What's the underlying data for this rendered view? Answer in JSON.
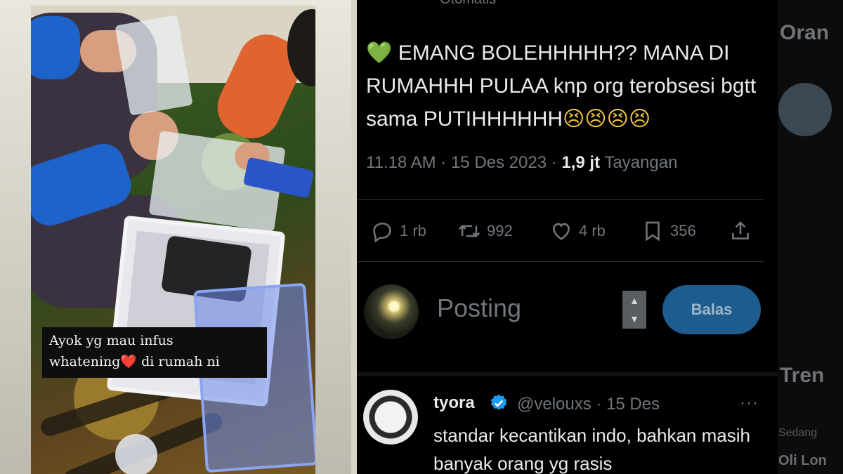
{
  "story": {
    "caption_line1": "Ayok yg mau infus",
    "caption_line2_prefix": "whatening",
    "caption_heart": "❤️",
    "caption_line2_suffix": " di rumah ni"
  },
  "tweet": {
    "top_label": "Otomatis",
    "heart_emoji": "💚",
    "text": "EMANG BOLEHHHHH??  MANA DI RUMAHHH PULAA knp org terobsesi bgtt sama PUTIHHHHHH",
    "emojis": "😣😣😣😣",
    "time": "11.18 AM · 15 Des 2023 · ",
    "views_count": "1,9 jt",
    "views_label": " Tayangan",
    "actions": {
      "replies": "1 rb",
      "retweets": "992",
      "likes": "4 rb",
      "bookmarks": "356"
    }
  },
  "composer": {
    "placeholder": "Posting",
    "reply_button": "Balas"
  },
  "reply": {
    "name": "tyora",
    "handle_date": "@velouxs · 15 Des",
    "more": "···",
    "text": "standar kecantikan indo, bahkan masih banyak orang yg rasis"
  },
  "sidebar": {
    "heading1": "Oran",
    "heading2": "Tren",
    "small_text": "Sedang",
    "trend": "Oli Lon"
  },
  "colors": {
    "background": "#000000",
    "text_primary": "#e7e9ea",
    "text_secondary": "#71767b",
    "reply_button": "#1d5c8f",
    "verified": "#1d9bf0",
    "story_caption_bg": "#0e0e0e"
  }
}
